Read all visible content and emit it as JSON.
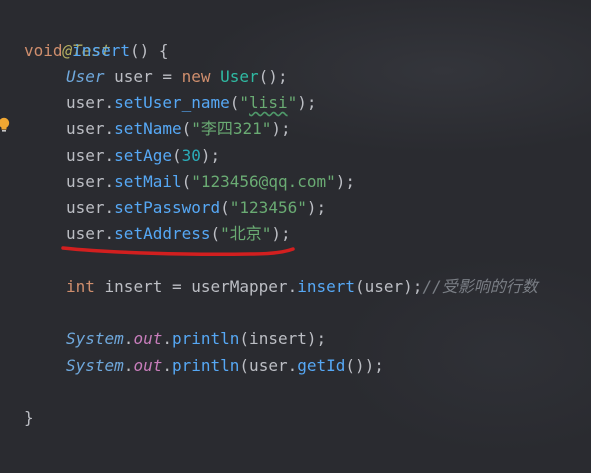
{
  "code": {
    "annotation": "@Test",
    "method_sig": {
      "kw_void": "void",
      "name": "insert",
      "paren": "() {"
    },
    "l_new_user": {
      "type": "User",
      "var": " user = ",
      "kw_new": "new",
      "ctor": "User",
      "tail": "();"
    },
    "l_username": {
      "obj": "user",
      "dot": ".",
      "method": "setUser_name",
      "open": "(",
      "str_q1": "\"",
      "str_val": "lisi",
      "str_q2": "\"",
      "close": ");"
    },
    "l_name": {
      "obj": "user",
      "dot": ".",
      "method": "setName",
      "open": "(",
      "str": "\"李四321\"",
      "close": ");"
    },
    "l_age": {
      "obj": "user",
      "dot": ".",
      "method": "setAge",
      "open": "(",
      "num": "30",
      "close": ");"
    },
    "l_mail": {
      "obj": "user",
      "dot": ".",
      "method": "setMail",
      "open": "(",
      "str": "\"123456@qq.com\"",
      "close": ");"
    },
    "l_password": {
      "obj": "user",
      "dot": ".",
      "method": "setPassword",
      "open": "(",
      "str": "\"123456\"",
      "close": ");"
    },
    "l_address": {
      "obj": "user",
      "dot": ".",
      "method": "setAddress",
      "open": "(",
      "str": "\"北京\"",
      "close": ");"
    },
    "l_insert": {
      "kw_int": "int",
      "var": " insert = userMapper",
      "dot": ".",
      "method": "insert",
      "args": "(user);",
      "comment": "//受影响的行数"
    },
    "l_print1": {
      "cls": "System",
      "dot1": ".",
      "field": "out",
      "dot2": ".",
      "method": "println",
      "args": "(insert);"
    },
    "l_print2": {
      "cls": "System",
      "dot1": ".",
      "field": "out",
      "dot2": ".",
      "method": "println",
      "open": "(user",
      "dot3": ".",
      "inner": "getId",
      "close": "());"
    },
    "closing": "}"
  },
  "colors": {
    "background": "#2a2b30",
    "keyword": "#cf8e6d",
    "method": "#56a8f5",
    "string": "#6aab73",
    "number": "#2aacb8",
    "annotation": "#b3ae60",
    "comment": "#7a7e85",
    "red_mark": "#d21f1f",
    "bulb": "#f0a732"
  },
  "icons": {
    "gutter": "lightbulb-icon"
  }
}
